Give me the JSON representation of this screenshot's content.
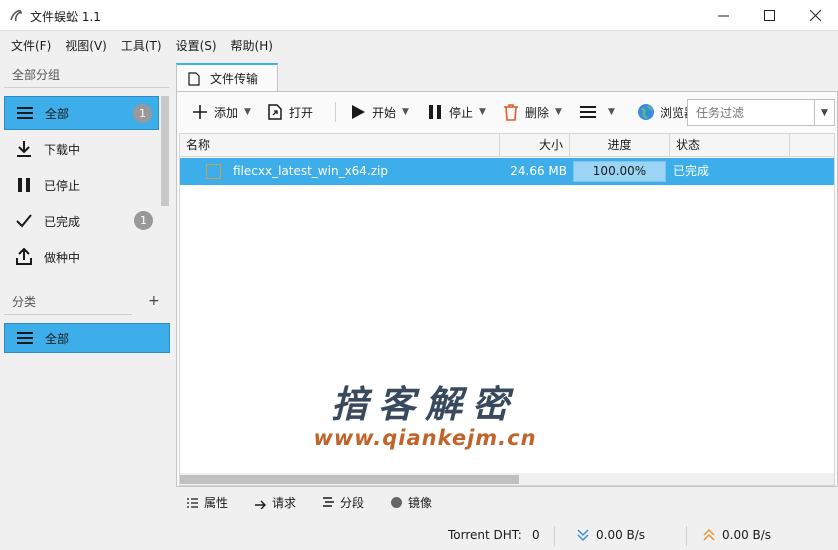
{
  "window": {
    "title": "文件蜈蚣 1.1"
  },
  "menu": [
    "文件(F)",
    "视图(V)",
    "工具(T)",
    "设置(S)",
    "帮助(H)"
  ],
  "sidebar": {
    "groups_label": "全部分组",
    "items": [
      {
        "label": "全部",
        "badge": "1",
        "icon": "list-icon",
        "active": true
      },
      {
        "label": "下载中",
        "icon": "download-icon"
      },
      {
        "label": "已停止",
        "icon": "pause-icon"
      },
      {
        "label": "已完成",
        "badge": "1",
        "icon": "check-icon"
      },
      {
        "label": "做种中",
        "icon": "upload-icon"
      }
    ],
    "category_label": "分类",
    "add_label": "+",
    "category_items": [
      {
        "label": "全部",
        "icon": "list-icon",
        "active": true
      }
    ]
  },
  "tab": {
    "label": "文件传输"
  },
  "toolbar": {
    "add": "添加",
    "open": "打开",
    "start": "开始",
    "stop": "停止",
    "delete": "删除",
    "browser": "浏览器",
    "filter_placeholder": "任务过滤"
  },
  "table": {
    "columns": [
      "名称",
      "大小",
      "进度",
      "状态"
    ],
    "rows": [
      {
        "name": "filecxx_latest_win_x64.zip",
        "size": "24.66 MB",
        "progress": "100.00%",
        "status": "已完成"
      }
    ]
  },
  "watermark": {
    "title": "揞客解密",
    "url": "www.qiankejm.cn"
  },
  "bottom_tabs": [
    "属性",
    "请求",
    "分段",
    "镜像"
  ],
  "statusbar": {
    "dht_label": "Torrent DHT:",
    "dht_value": "0",
    "down_speed": "0.00 B/s",
    "up_speed": "0.00 B/s"
  },
  "colors": {
    "accent": "#3daee9",
    "progress_fill": "#9bd4f5",
    "watermark_title": "#3a4a5e",
    "watermark_url": "#c0642a"
  }
}
